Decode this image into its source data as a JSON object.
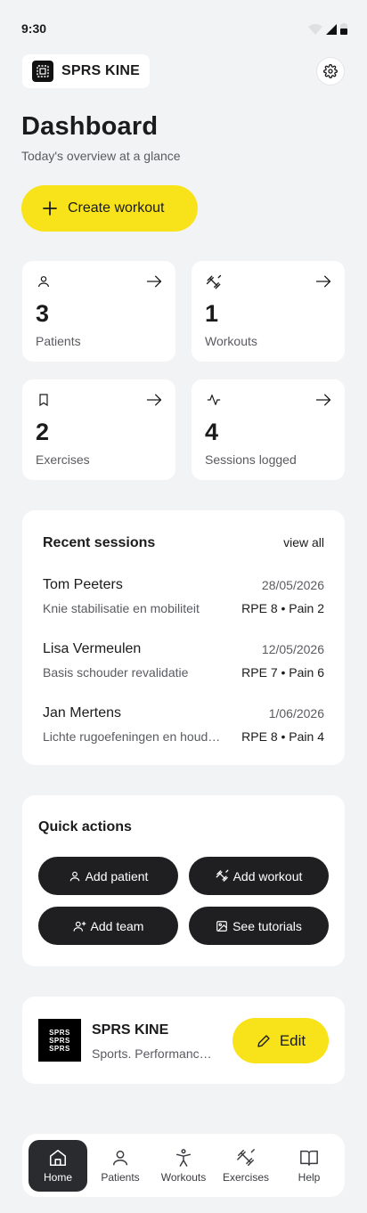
{
  "status_bar": {
    "time": "9:30"
  },
  "brand": {
    "name": "SPRS KINE"
  },
  "header": {
    "title": "Dashboard",
    "subtitle": "Today's overview at a glance"
  },
  "create_button": {
    "label": "Create workout"
  },
  "stats": [
    {
      "value": "3",
      "label": "Patients",
      "icon": "person-icon"
    },
    {
      "value": "1",
      "label": "Workouts",
      "icon": "dumbbell-icon"
    },
    {
      "value": "2",
      "label": "Exercises",
      "icon": "bookmark-icon"
    },
    {
      "value": "4",
      "label": "Sessions logged",
      "icon": "activity-icon"
    }
  ],
  "recent_sessions": {
    "title": "Recent sessions",
    "view_all": "view all",
    "items": [
      {
        "name": "Tom Peeters",
        "date": "28/05/2026",
        "program": "Knie stabilisatie en mobiliteit",
        "rpe_pain": "RPE 8 • Pain 2"
      },
      {
        "name": "Lisa Vermeulen",
        "date": "12/05/2026",
        "program": "Basis schouder revalidatie",
        "rpe_pain": "RPE 7 • Pain 6"
      },
      {
        "name": "Jan Mertens",
        "date": "1/06/2026",
        "program": "Lichte rugoefeningen en houding",
        "rpe_pain": "RPE 8 • Pain 4"
      }
    ]
  },
  "quick_actions": {
    "title": "Quick actions",
    "buttons": [
      {
        "label": "Add patient",
        "icon": "person-icon"
      },
      {
        "label": "Add workout",
        "icon": "dumbbell-icon"
      },
      {
        "label": "Add team",
        "icon": "user-plus-icon"
      },
      {
        "label": "See tutorials",
        "icon": "image-icon"
      }
    ]
  },
  "profile": {
    "name": "SPRS KINE",
    "description": "Sports. Performance. Recovery.",
    "edit_label": "Edit",
    "logo_lines": [
      "SPRS",
      "SPRS",
      "SPRS"
    ]
  },
  "bottom_nav": [
    {
      "label": "Home",
      "icon": "home-icon",
      "active": true
    },
    {
      "label": "Patients",
      "icon": "person-icon",
      "active": false
    },
    {
      "label": "Workouts",
      "icon": "figure-icon",
      "active": false
    },
    {
      "label": "Exercises",
      "icon": "dumbbell-icon",
      "active": false
    },
    {
      "label": "Help",
      "icon": "book-icon",
      "active": false
    }
  ],
  "colors": {
    "accent": "#f8e31b",
    "dark": "#1f1f21",
    "background": "#f2f3f5"
  }
}
